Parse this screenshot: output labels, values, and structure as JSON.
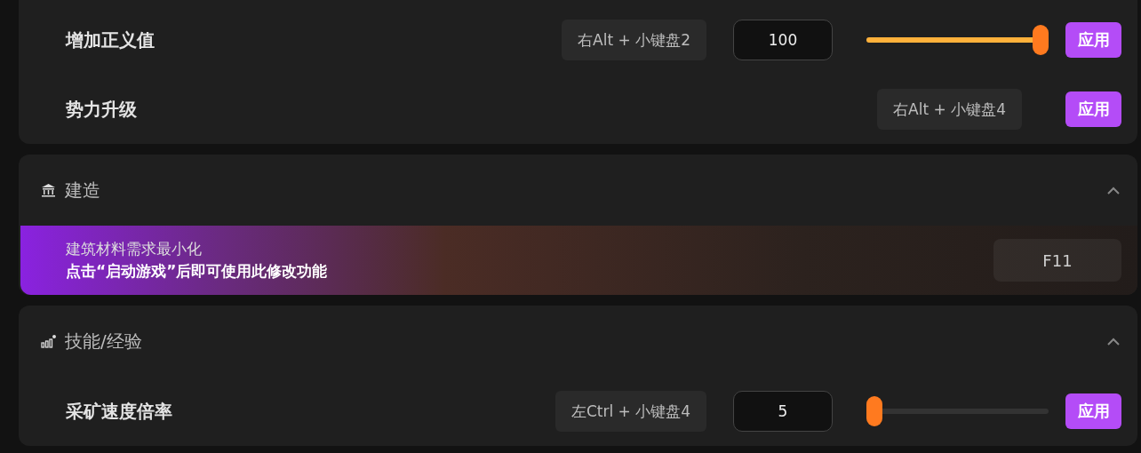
{
  "sections": [
    {
      "kind": "continued",
      "rows": [
        {
          "kind": "slider",
          "label": "增加正义值",
          "hotkey": "右Alt + 小键盘2",
          "value": "100",
          "level": 1,
          "button": "应用"
        },
        {
          "kind": "button",
          "label": "势力升级",
          "hotkey": "右Alt + 小键盘4",
          "button": "应用"
        }
      ]
    },
    {
      "kind": "group",
      "title": "建造",
      "expanded": true,
      "banner": {
        "title": "建筑材料需求最小化",
        "note": "点击“启动游戏”后即可使用此修改功能",
        "hotkey": "F11"
      }
    },
    {
      "kind": "group",
      "title": "技能/经验",
      "expanded": true,
      "rows": [
        {
          "kind": "slider",
          "label": "采矿速度倍率",
          "hotkey": "左Ctrl + 小键盘4",
          "value": "5",
          "level": 0,
          "button": "应用"
        }
      ]
    }
  ]
}
